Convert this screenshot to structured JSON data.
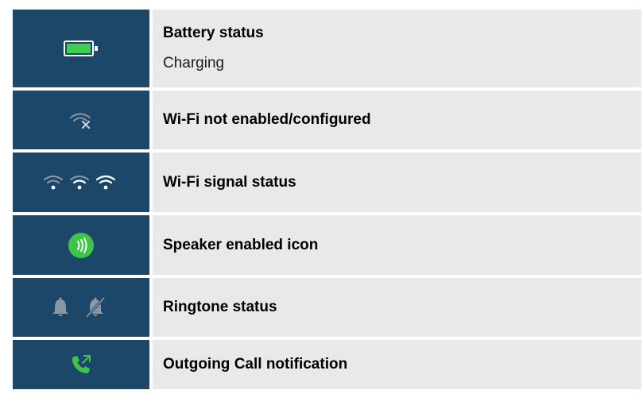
{
  "colors": {
    "icon_background": "#1d4768",
    "text_background": "#e9e9e9",
    "battery_fill": "#39d24a",
    "speaker_green": "#3fc44a",
    "muted_grey": "#8a98a4"
  },
  "rows": [
    {
      "icon": "battery-charging-icon",
      "title": "Battery status",
      "subtitle": "Charging"
    },
    {
      "icon": "wifi-disabled-icon",
      "title": "Wi-Fi not enabled/configured"
    },
    {
      "icon": "wifi-signal-levels-icon",
      "title": "Wi-Fi signal status"
    },
    {
      "icon": "speaker-enabled-icon",
      "title": "Speaker enabled icon"
    },
    {
      "icon": "ringtone-bell-icon",
      "title": "Ringtone status"
    },
    {
      "icon": "outgoing-call-icon",
      "title": "Outgoing Call notification"
    }
  ]
}
